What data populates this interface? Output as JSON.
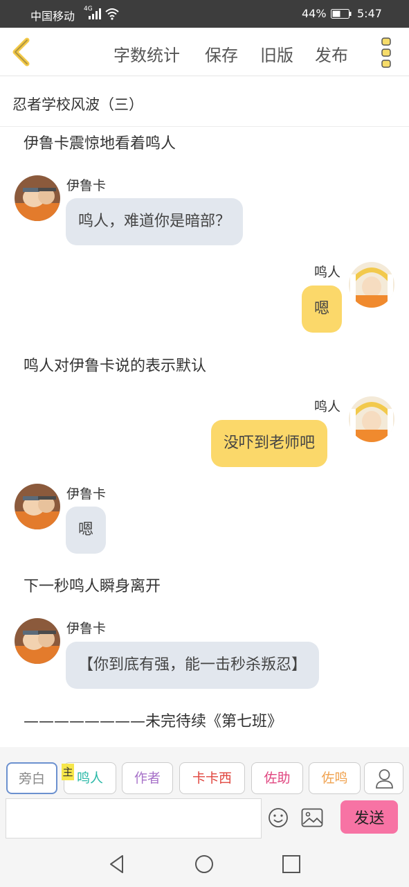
{
  "status_bar": {
    "carrier": "中国移动",
    "network": "4G",
    "battery_pct": "44%",
    "time": "5:47"
  },
  "toolbar": {
    "back_icon": "chevron-left-icon",
    "items": [
      "字数统计",
      "保存",
      "旧版",
      "发布"
    ],
    "more_icon": "more-vertical-icon",
    "accent": "#f3c948"
  },
  "doc": {
    "title": "忍者学校风波（三）"
  },
  "chat": {
    "narrations": [
      "伊鲁卡震惊地看着鸣人",
      "鸣人对伊鲁卡说的表示默认",
      "下一秒鸣人瞬身离开",
      "————————未完待续《第七班》"
    ],
    "messages": [
      {
        "side": "left",
        "name": "伊鲁卡",
        "text": "鸣人，难道你是暗部？"
      },
      {
        "side": "right",
        "name": "鸣人",
        "text": "嗯"
      },
      {
        "side": "right",
        "name": "鸣人",
        "text": "没吓到老师吧"
      },
      {
        "side": "left",
        "name": "伊鲁卡",
        "text": "嗯"
      },
      {
        "side": "left",
        "name": "伊鲁卡",
        "text": "【你到底有强，能一击秒杀叛忍】"
      }
    ],
    "left_bubble_color": "#e2e7ee",
    "right_bubble_color": "#fbd86a"
  },
  "composer": {
    "roles": [
      {
        "label": "旁白",
        "color": "#888888"
      },
      {
        "label": "鸣人",
        "color": "#2cb9a8"
      },
      {
        "label": "作者",
        "color": "#a772c9"
      },
      {
        "label": "卡卡西",
        "color": "#e0453e"
      },
      {
        "label": "佐助",
        "color": "#e0457f"
      },
      {
        "label": "佐鸣",
        "color": "#f0a24f"
      }
    ],
    "host_badge": "主",
    "input_value": "",
    "send_label": "发送",
    "send_color": "#f773a4"
  }
}
